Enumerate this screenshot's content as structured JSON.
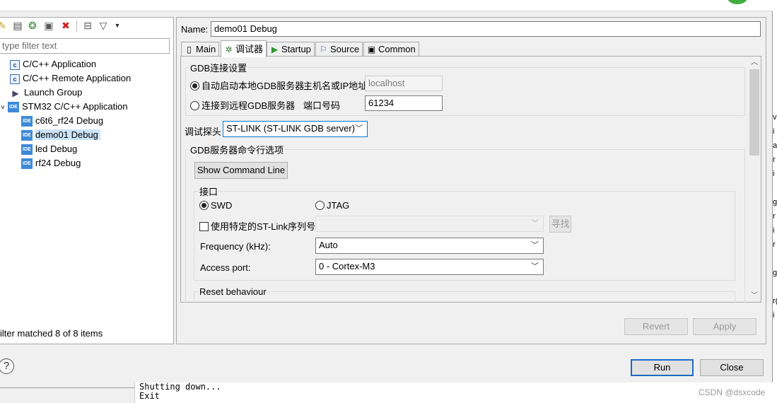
{
  "dialog": {
    "green_accent": "#3fae3f"
  },
  "left": {
    "toolbar_icons": [
      "new-config-icon",
      "new-prototype-icon",
      "duplicate-icon",
      "export-icon",
      "delete-icon",
      "collapse-all-icon",
      "filter-icon",
      "dropdown-icon"
    ],
    "filter_placeholder": "type filter text",
    "tree": [
      {
        "label": "C/C++ Application",
        "icon": "c-config-icon"
      },
      {
        "label": "C/C++ Remote Application",
        "icon": "c-config-icon"
      },
      {
        "label": "Launch Group",
        "icon": "launch-group-icon"
      },
      {
        "label": "STM32 C/C++ Application",
        "icon": "ide-icon"
      },
      {
        "label": "c6t6_rf24 Debug",
        "icon": "ide-icon"
      },
      {
        "label": "demo01 Debug",
        "icon": "ide-icon",
        "selected": true
      },
      {
        "label": "led Debug",
        "icon": "ide-icon"
      },
      {
        "label": "rf24 Debug",
        "icon": "ide-icon"
      }
    ],
    "expand_marker": "˅",
    "filter_status": "ilter matched 8 of 8 items",
    "help": "?"
  },
  "right": {
    "name_label": "Name:",
    "name_value": "demo01 Debug",
    "tabs": [
      {
        "label": "Main",
        "icon": "main-tab-icon"
      },
      {
        "label": "调试器",
        "icon": "debugger-tab-icon",
        "active": true
      },
      {
        "label": "Startup",
        "icon": "startup-tab-icon"
      },
      {
        "label": "Source",
        "icon": "source-tab-icon"
      },
      {
        "label": "Common",
        "icon": "common-tab-icon"
      }
    ],
    "gdb_group": {
      "title": "GDB连接设置",
      "auto_start_label": "自动启动本地GDB服务器",
      "host_label": "主机名或IP地址",
      "host_value": "localhost",
      "remote_label": "连接到远程GDB服务器",
      "port_label": "端口号码",
      "port_value": "61234"
    },
    "probe_label": "调试探头",
    "probe_value": "ST-LINK (ST-LINK GDB server)",
    "server_group": {
      "title": "GDB服务器命令行选项",
      "show_cmd_button": "Show Command Line",
      "interface": {
        "title": "接口",
        "swd": "SWD",
        "jtag": "JTAG",
        "serial_label": "使用特定的ST-Link序列号",
        "serial_value": "",
        "find_button": "寻找",
        "freq_label": "Frequency (kHz):",
        "freq_value": "Auto",
        "access_label": "Access port:",
        "access_value": "0 - Cortex-M3"
      },
      "reset_title": "Reset behaviour"
    },
    "revert_button": "Revert",
    "apply_button": "Apply"
  },
  "footer": {
    "run_button": "Run",
    "close_button": "Close"
  },
  "background": {
    "console_lines": [
      "Shutting down...",
      "Exit"
    ],
    "watermark": "CSDN @dsxcode",
    "edge_chars": [
      "v",
      "i",
      "a",
      "r",
      "i",
      "g",
      "r",
      "i",
      "r",
      "g",
      "r(",
      "i"
    ]
  }
}
